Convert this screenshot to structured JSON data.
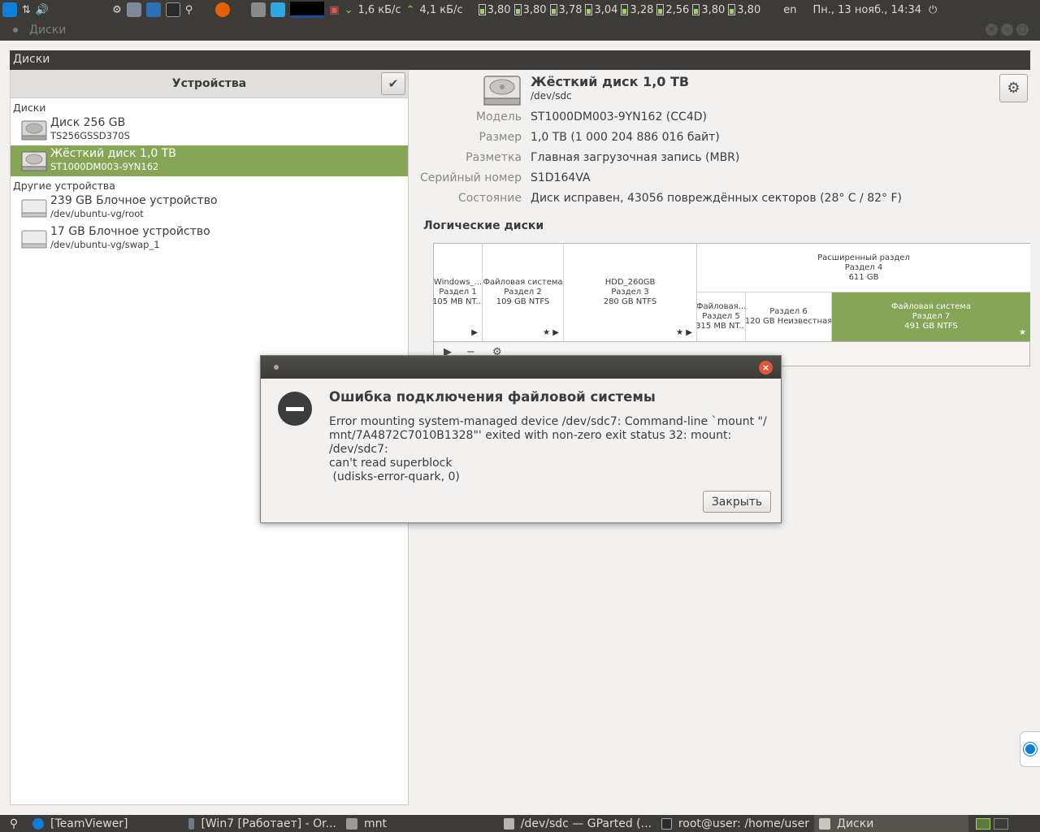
{
  "top_panel": {
    "net_down": "1,6 кБ/с",
    "net_up": "4,1 кБ/с",
    "cpu_freqs": [
      "3,80",
      "3,80",
      "3,78",
      "3,04",
      "3,28",
      "2,56",
      "3,80",
      "3,80"
    ],
    "keyboard_layout": "en",
    "clock": "Пн., 13 нояб., 14:34"
  },
  "window": {
    "title": "Диски"
  },
  "app": {
    "header_title": "Диски",
    "devices_heading": "Устройства",
    "groups": [
      {
        "label": "Диски",
        "items": [
          {
            "name": "Диск 256 GB",
            "sub": "TS256GSSD370S",
            "selected": false
          },
          {
            "name": "Жёсткий диск 1,0 TB",
            "sub": "ST1000DM003-9YN162",
            "selected": true
          }
        ]
      },
      {
        "label": "Другие устройства",
        "items": [
          {
            "name": "239 GB Блочное устройство",
            "sub": "/dev/ubuntu-vg/root",
            "selected": false
          },
          {
            "name": "17 GB Блочное устройство",
            "sub": "/dev/ubuntu-vg/swap_1",
            "selected": false
          }
        ]
      }
    ]
  },
  "disk": {
    "title": "Жёсткий диск 1,0 TB",
    "path": "/dev/sdc",
    "props": [
      {
        "key": "Модель",
        "value": "ST1000DM003-9YN162 (CC4D)"
      },
      {
        "key": "Размер",
        "value": "1,0 TB (1 000 204 886 016 байт)"
      },
      {
        "key": "Разметка",
        "value": "Главная загрузочная запись (MBR)"
      },
      {
        "key": "Серийный номер",
        "value": "S1D164VA"
      },
      {
        "key": "Состояние",
        "value": "Диск исправен, 43056 повреждённых секторов (28° C / 82° F)"
      }
    ],
    "volumes_title": "Логические диски",
    "volumes": [
      {
        "l1": "Windows_...",
        "l2": "Раздел 1",
        "l3": "105 MB NT..."
      },
      {
        "l1": "Файловая система",
        "l2": "Раздел 2",
        "l3": "109 GB NTFS"
      },
      {
        "l1": "HDD_260GB",
        "l2": "Раздел 3",
        "l3": "280 GB NTFS"
      },
      {
        "l1": "Расширенный раздел",
        "l2": "Раздел 4",
        "l3": "611 GB"
      },
      {
        "l1": "Файловая...",
        "l2": "Раздел 5",
        "l3": "315 MB NT..."
      },
      {
        "l1": "Раздел 6",
        "l2": "120 GB Неизвестная",
        "l3": ""
      },
      {
        "l1": "Файловая система",
        "l2": "Раздел 7",
        "l3": "491 GB NTFS"
      }
    ]
  },
  "dialog": {
    "heading": "Ошибка подключения файловой системы",
    "message": "Error mounting system-managed device /dev/sdc7: Command-line `mount \"/\nmnt/7A4872C7010B1328\"' exited with non-zero exit status 32: mount: /dev/sdc7:\ncan't read superblock\n (udisks-error-quark, 0)",
    "close_label": "Закрыть"
  },
  "taskbar": [
    {
      "label": "[TeamViewer]",
      "active": false
    },
    {
      "label": "[Win7 [Работает] - Or...",
      "active": false
    },
    {
      "label": "mnt",
      "active": false
    },
    {
      "label": "/dev/sdc — GParted (...",
      "active": false
    },
    {
      "label": "root@user: /home/user",
      "active": false
    },
    {
      "label": "Диски",
      "active": true
    }
  ]
}
